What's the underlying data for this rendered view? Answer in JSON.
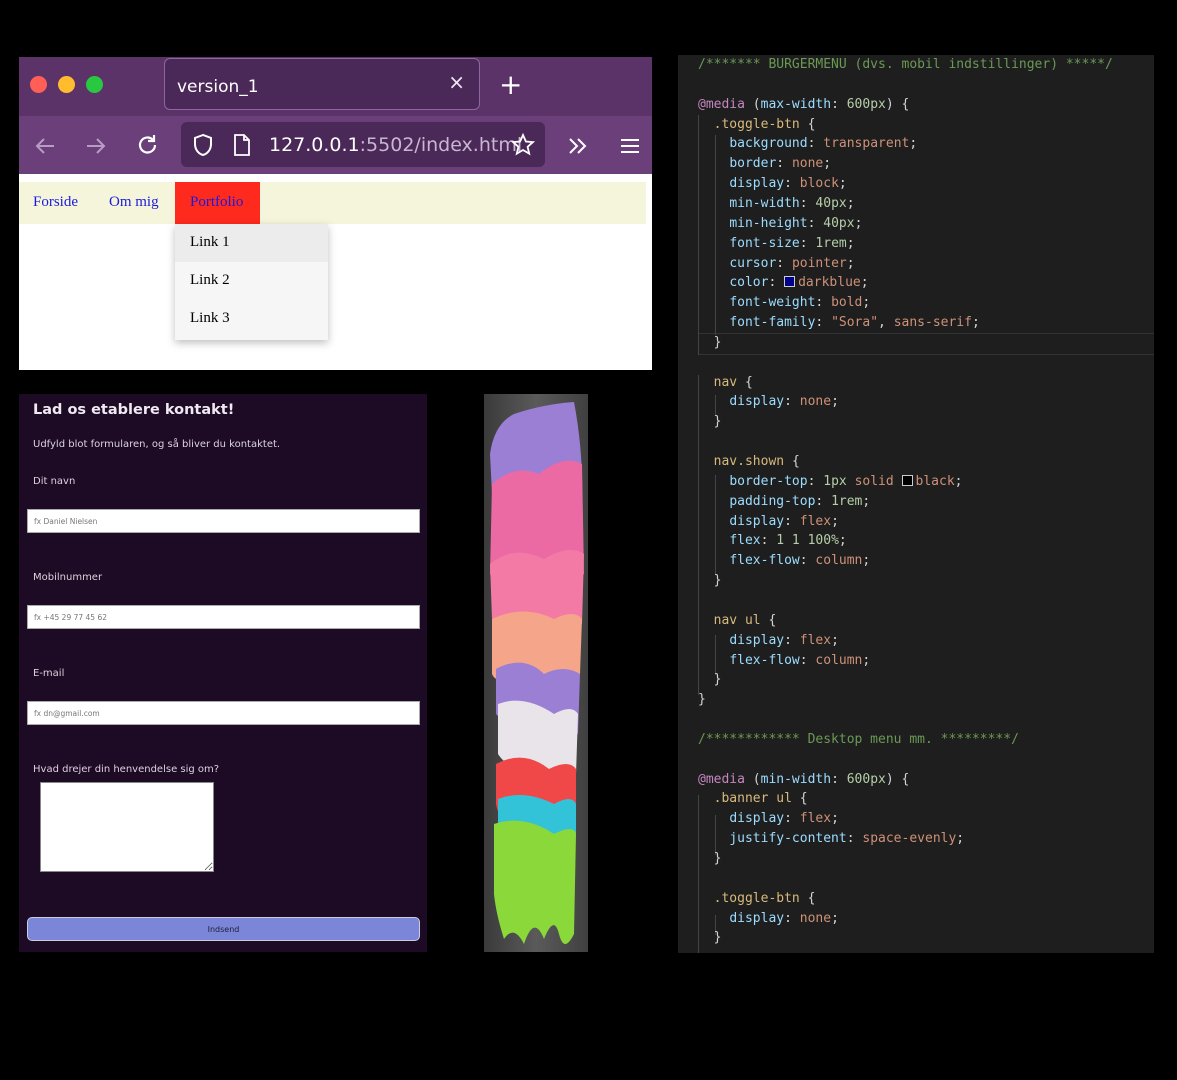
{
  "browser": {
    "tab_title": "version_1",
    "tab_close": "×",
    "new_tab": "+",
    "url_host": "127.0.0.1",
    "url_path": ":5502/index.html",
    "traffic_colors": [
      "#ff5f57",
      "#febc2e",
      "#28c840"
    ]
  },
  "site": {
    "nav": [
      "Forside",
      "Om mig"
    ],
    "active_nav": "Portfolio",
    "dropdown": [
      "Link 1",
      "Link 2",
      "Link 3"
    ]
  },
  "form": {
    "title": "Lad os etablere kontakt!",
    "subtitle": "Udfyld blot formularen, og så bliver du kontaktet.",
    "fields": [
      {
        "label": "Dit navn",
        "placeholder": "fx Daniel Nielsen"
      },
      {
        "label": "Mobilnummer",
        "placeholder": "fx +45 29 77 45 62"
      },
      {
        "label": "E-mail",
        "placeholder": "fx dn@gmail.com"
      }
    ],
    "message_label": "Hvad drejer din henvendelse sig om?",
    "submit": "Indsend"
  },
  "code": {
    "lines": [
      [
        [
          "/******* BURGERMENU (dvs. mobil indstillinger) *****/",
          "cm"
        ]
      ],
      [],
      [
        [
          "@media ",
          "at"
        ],
        [
          "(",
          "br"
        ],
        [
          "max-width",
          "pr"
        ],
        [
          ": ",
          "br"
        ],
        [
          "600px",
          "nm"
        ],
        [
          ") {",
          "br"
        ]
      ],
      [
        [
          "  ",
          "br"
        ],
        [
          ".toggle-btn ",
          "sel"
        ],
        [
          "{",
          "br"
        ]
      ],
      [
        [
          "    ",
          "br"
        ],
        [
          "background",
          "pr"
        ],
        [
          ": ",
          "br"
        ],
        [
          "transparent",
          "vl"
        ],
        [
          ";",
          "br"
        ]
      ],
      [
        [
          "    ",
          "br"
        ],
        [
          "border",
          "pr"
        ],
        [
          ": ",
          "br"
        ],
        [
          "none",
          "vl"
        ],
        [
          ";",
          "br"
        ]
      ],
      [
        [
          "    ",
          "br"
        ],
        [
          "display",
          "pr"
        ],
        [
          ": ",
          "br"
        ],
        [
          "block",
          "vl"
        ],
        [
          ";",
          "br"
        ]
      ],
      [
        [
          "    ",
          "br"
        ],
        [
          "min-width",
          "pr"
        ],
        [
          ": ",
          "br"
        ],
        [
          "40px",
          "nm"
        ],
        [
          ";",
          "br"
        ]
      ],
      [
        [
          "    ",
          "br"
        ],
        [
          "min-height",
          "pr"
        ],
        [
          ": ",
          "br"
        ],
        [
          "40px",
          "nm"
        ],
        [
          ";",
          "br"
        ]
      ],
      [
        [
          "    ",
          "br"
        ],
        [
          "font-size",
          "pr"
        ],
        [
          ": ",
          "br"
        ],
        [
          "1rem",
          "nm"
        ],
        [
          ";",
          "br"
        ]
      ],
      [
        [
          "    ",
          "br"
        ],
        [
          "cursor",
          "pr"
        ],
        [
          ": ",
          "br"
        ],
        [
          "pointer",
          "vl"
        ],
        [
          ";",
          "br"
        ]
      ],
      [
        [
          "    ",
          "br"
        ],
        [
          "color",
          "pr"
        ],
        [
          ": ",
          "br"
        ],
        [
          "#00008b",
          "swatch"
        ],
        [
          "darkblue",
          "vl"
        ],
        [
          ";",
          "br"
        ]
      ],
      [
        [
          "    ",
          "br"
        ],
        [
          "font-weight",
          "pr"
        ],
        [
          ": ",
          "br"
        ],
        [
          "bold",
          "vl"
        ],
        [
          ";",
          "br"
        ]
      ],
      [
        [
          "    ",
          "br"
        ],
        [
          "font-family",
          "pr"
        ],
        [
          ": ",
          "br"
        ],
        [
          "\"Sora\"",
          "vl"
        ],
        [
          ", ",
          "br"
        ],
        [
          "sans-serif",
          "vl"
        ],
        [
          ";",
          "br"
        ]
      ],
      [
        [
          "  }",
          "br"
        ]
      ],
      [],
      [
        [
          "  ",
          "br"
        ],
        [
          "nav ",
          "sel"
        ],
        [
          "{",
          "br"
        ]
      ],
      [
        [
          "    ",
          "br"
        ],
        [
          "display",
          "pr"
        ],
        [
          ": ",
          "br"
        ],
        [
          "none",
          "vl"
        ],
        [
          ";",
          "br"
        ]
      ],
      [
        [
          "  }",
          "br"
        ]
      ],
      [],
      [
        [
          "  ",
          "br"
        ],
        [
          "nav.shown ",
          "sel"
        ],
        [
          "{",
          "br"
        ]
      ],
      [
        [
          "    ",
          "br"
        ],
        [
          "border-top",
          "pr"
        ],
        [
          ": ",
          "br"
        ],
        [
          "1px ",
          "nm"
        ],
        [
          "solid ",
          "vl"
        ],
        [
          "#000000",
          "swatch"
        ],
        [
          "black",
          "vl"
        ],
        [
          ";",
          "br"
        ]
      ],
      [
        [
          "    ",
          "br"
        ],
        [
          "padding-top",
          "pr"
        ],
        [
          ": ",
          "br"
        ],
        [
          "1rem",
          "nm"
        ],
        [
          ";",
          "br"
        ]
      ],
      [
        [
          "    ",
          "br"
        ],
        [
          "display",
          "pr"
        ],
        [
          ": ",
          "br"
        ],
        [
          "flex",
          "vl"
        ],
        [
          ";",
          "br"
        ]
      ],
      [
        [
          "    ",
          "br"
        ],
        [
          "flex",
          "pr"
        ],
        [
          ": ",
          "br"
        ],
        [
          "1 1 100%",
          "nm"
        ],
        [
          ";",
          "br"
        ]
      ],
      [
        [
          "    ",
          "br"
        ],
        [
          "flex-flow",
          "pr"
        ],
        [
          ": ",
          "br"
        ],
        [
          "column",
          "vl"
        ],
        [
          ";",
          "br"
        ]
      ],
      [
        [
          "  }",
          "br"
        ]
      ],
      [],
      [
        [
          "  ",
          "br"
        ],
        [
          "nav ul ",
          "sel"
        ],
        [
          "{",
          "br"
        ]
      ],
      [
        [
          "    ",
          "br"
        ],
        [
          "display",
          "pr"
        ],
        [
          ": ",
          "br"
        ],
        [
          "flex",
          "vl"
        ],
        [
          ";",
          "br"
        ]
      ],
      [
        [
          "    ",
          "br"
        ],
        [
          "flex-flow",
          "pr"
        ],
        [
          ": ",
          "br"
        ],
        [
          "column",
          "vl"
        ],
        [
          ";",
          "br"
        ]
      ],
      [
        [
          "  }",
          "br"
        ]
      ],
      [
        [
          "}",
          "br"
        ]
      ],
      [],
      [
        [
          "/************ Desktop menu mm. *********/",
          "cm"
        ]
      ],
      [],
      [
        [
          "@media ",
          "at"
        ],
        [
          "(",
          "br"
        ],
        [
          "min-width",
          "pr"
        ],
        [
          ": ",
          "br"
        ],
        [
          "600px",
          "nm"
        ],
        [
          ") {",
          "br"
        ]
      ],
      [
        [
          "  ",
          "br"
        ],
        [
          ".banner ul ",
          "sel"
        ],
        [
          "{",
          "br"
        ]
      ],
      [
        [
          "    ",
          "br"
        ],
        [
          "display",
          "pr"
        ],
        [
          ": ",
          "br"
        ],
        [
          "flex",
          "vl"
        ],
        [
          ";",
          "br"
        ]
      ],
      [
        [
          "    ",
          "br"
        ],
        [
          "justify-content",
          "pr"
        ],
        [
          ": ",
          "br"
        ],
        [
          "space-evenly",
          "vl"
        ],
        [
          ";",
          "br"
        ]
      ],
      [
        [
          "  }",
          "br"
        ]
      ],
      [],
      [
        [
          "  ",
          "br"
        ],
        [
          ".toggle-btn ",
          "sel"
        ],
        [
          "{",
          "br"
        ]
      ],
      [
        [
          "    ",
          "br"
        ],
        [
          "display",
          "pr"
        ],
        [
          ": ",
          "br"
        ],
        [
          "none",
          "vl"
        ],
        [
          ";",
          "br"
        ]
      ],
      [
        [
          "  }",
          "br"
        ]
      ]
    ]
  }
}
